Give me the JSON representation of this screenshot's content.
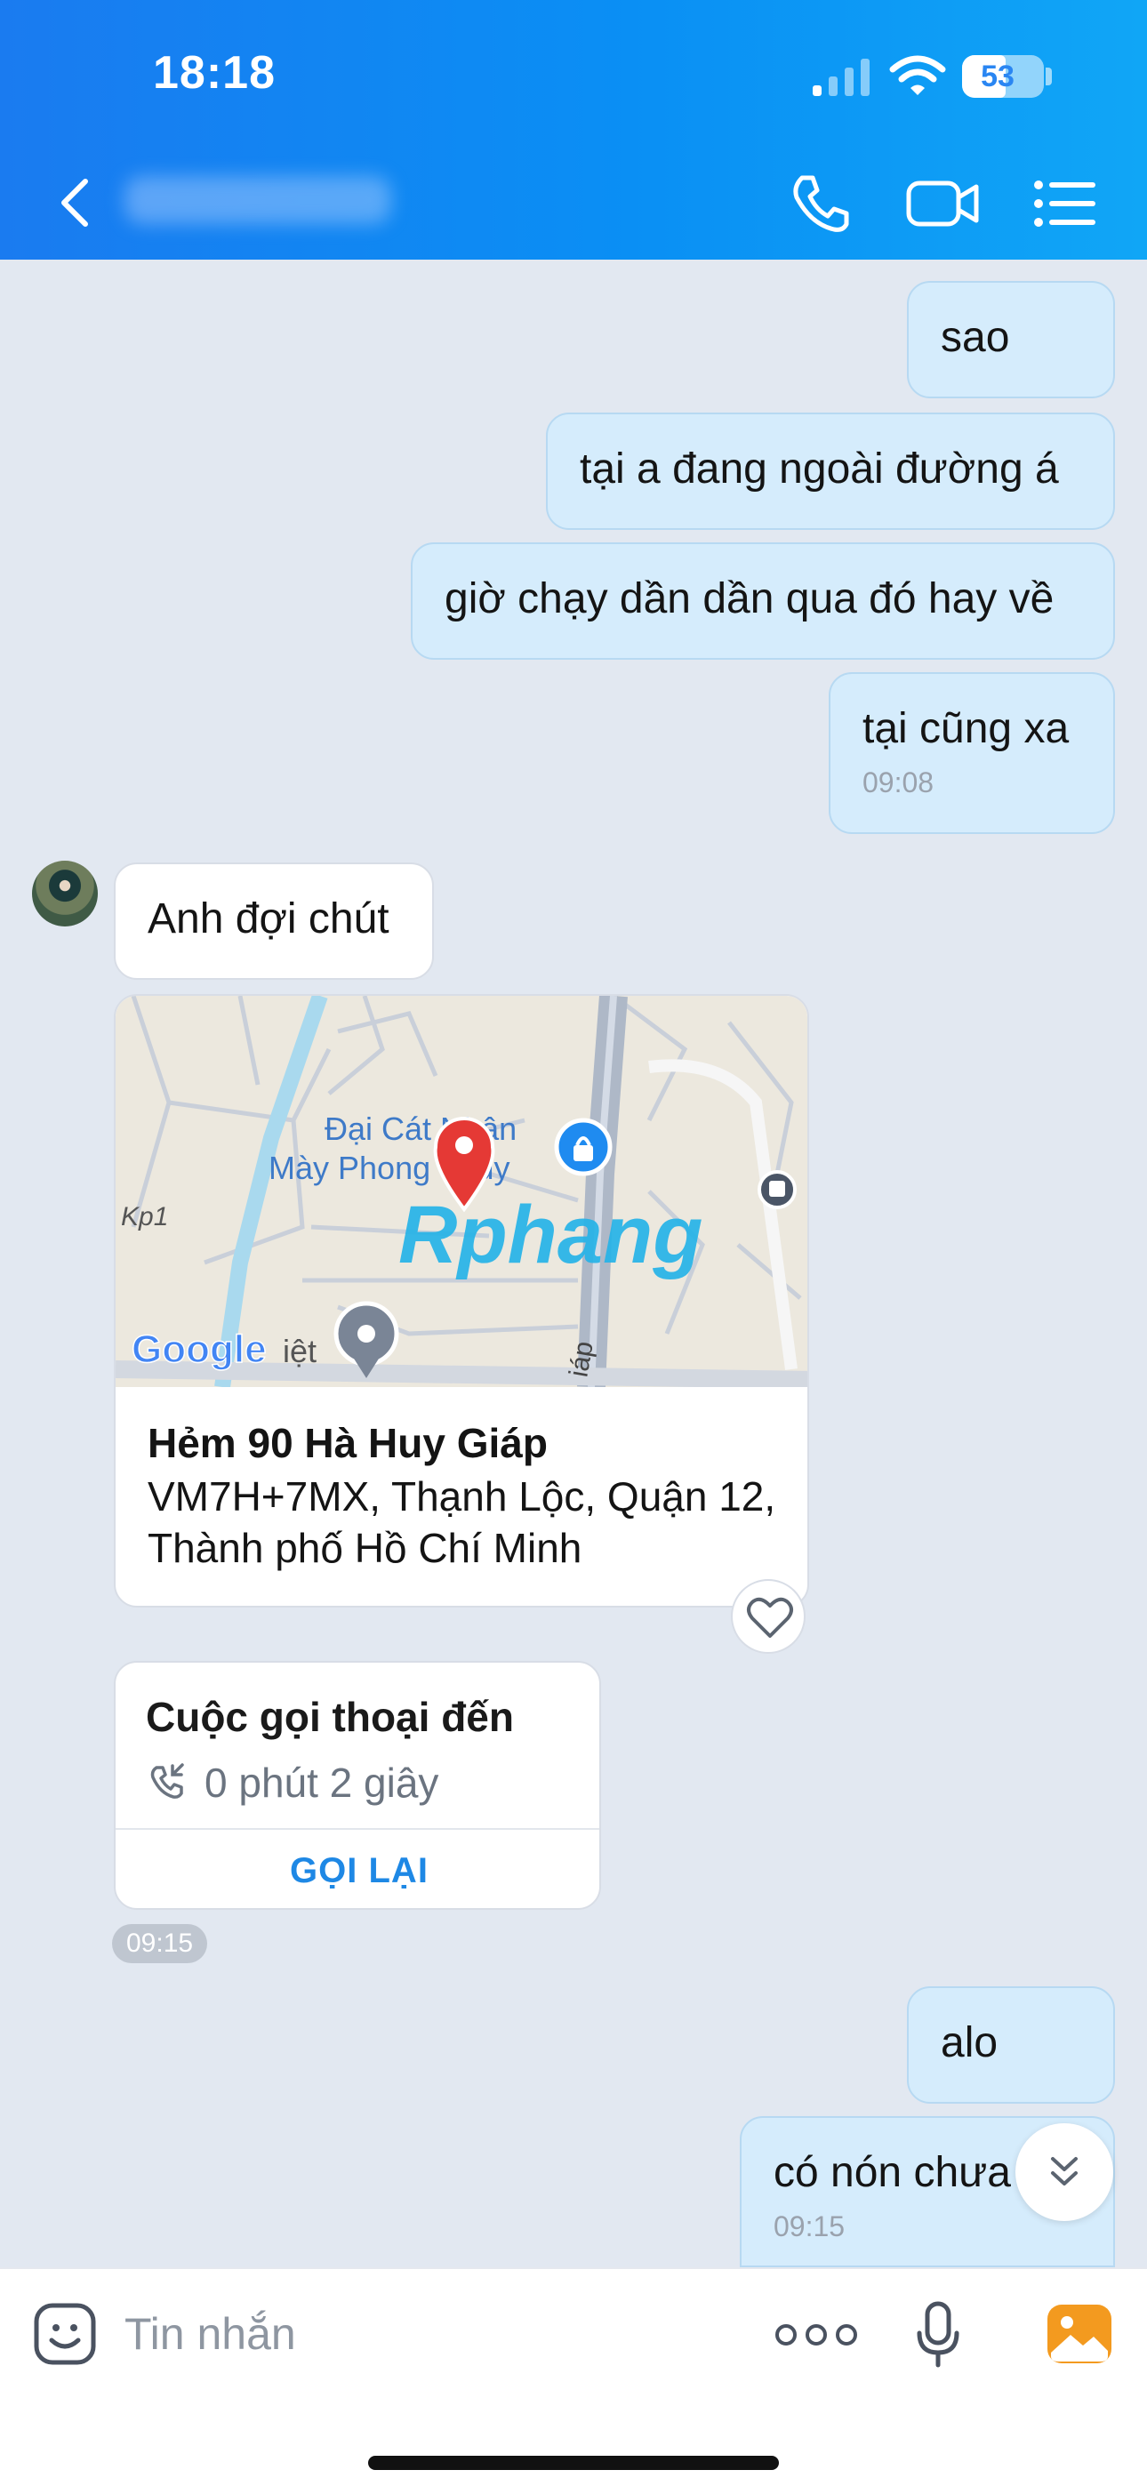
{
  "status_bar": {
    "time": "18:18",
    "battery": "53",
    "battery_level": 0.53
  },
  "header": {
    "contact_name_blurred": true,
    "icons": [
      "back-icon",
      "phone-icon",
      "video-call-icon",
      "menu-list-icon"
    ]
  },
  "messages": {
    "out_1": {
      "text": "sao"
    },
    "out_2": {
      "text": "tại a đang ngoài đường á"
    },
    "out_3": {
      "text": "giờ chạy dần dần qua đó hay về"
    },
    "out_4": {
      "text": "tại cũng xa",
      "time": "09:08"
    },
    "in_1": {
      "text": "Anh đợi chút"
    },
    "location": {
      "map_labels": {
        "place": "Đại Cát Nhân",
        "place_line2": "Mày Phong Thủy",
        "kp": "Kp1",
        "google": "Google",
        "viet": "iệt",
        "road": "iáp",
        "watermark": "Rphang"
      },
      "title": "Hẻm 90 Hà Huy Giáp",
      "address": "VM7H+7MX, Thạnh Lộc, Quận 12, Thành phố Hồ Chí Minh"
    },
    "call": {
      "title": "Cuộc gọi thoại đến",
      "duration": "0 phút 2 giây",
      "call_back": "GỌI LẠI"
    },
    "in_time": "09:15",
    "out_5": {
      "text": "alo"
    },
    "out_6": {
      "text": "có nón chưa",
      "time": "09:15"
    }
  },
  "input": {
    "placeholder": "Tin nhắn"
  },
  "colors": {
    "header_gradient_start": "#1a7bf0",
    "header_gradient_end": "#10a6f6",
    "chat_background": "#e2e8f1",
    "outgoing_bubble": "#d5ecfc",
    "incoming_bubble": "#ffffff",
    "accent": "#1e88e5",
    "map_pin": "#e53935"
  }
}
